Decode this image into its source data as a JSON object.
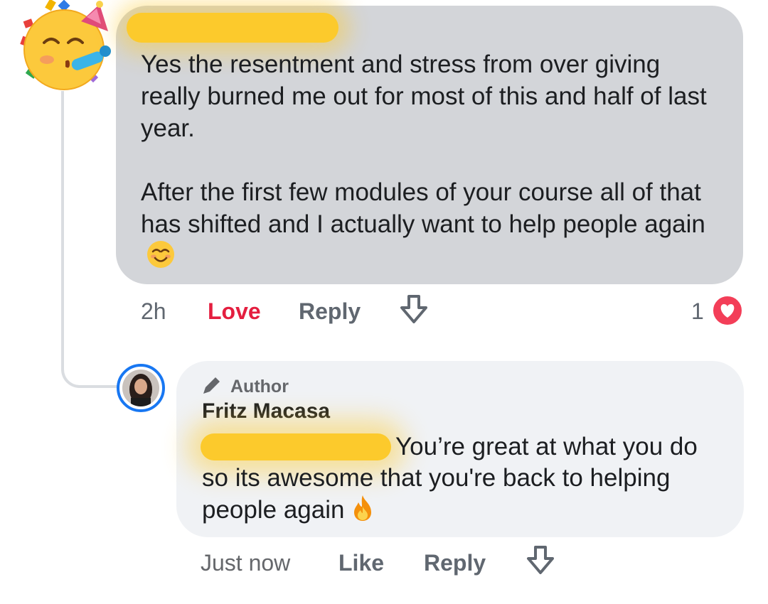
{
  "thread": {
    "root_comment": {
      "avatar_icon": "partying-face-emoji",
      "author_redacted": true,
      "text_paragraph_1": "Yes the resentment and stress from over giving really burned me out for most of this and half of last year.",
      "text_paragraph_2": "After the first few modules of your course all of that has shifted and I actually want to help people again",
      "text_emoji": "smiling-face-with-smiling-eyes",
      "timestamp": "2h",
      "reaction_label": "Love",
      "reply_label": "Reply",
      "reaction_count": "1",
      "reaction_icon": "heart-icon"
    },
    "reply_comment": {
      "badge_label": "Author",
      "author_name": "Fritz Macasa",
      "mention_redacted": true,
      "text_line_1": "You’re great at what you do",
      "text_rest": "so its awesome that you're back to helping people again",
      "text_emoji": "fire-emoji",
      "timestamp": "Just now",
      "like_label": "Like",
      "reply_label": "Reply"
    }
  },
  "colors": {
    "root_bubble": "#d3d5d9",
    "reply_bubble": "#f0f2f5",
    "love_red": "#e41e3f",
    "avatar_ring": "#1877f2",
    "redaction_highlight": "#fcca2c"
  }
}
